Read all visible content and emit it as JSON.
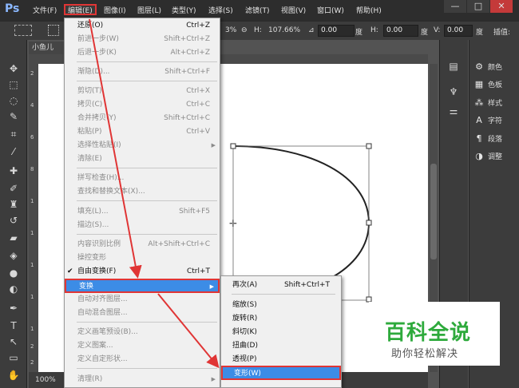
{
  "app": {
    "logo": "Ps"
  },
  "menubar": {
    "items": [
      "文件(F)",
      "编辑(E)",
      "图像(I)",
      "图层(L)",
      "类型(Y)",
      "选择(S)",
      "滤镜(T)",
      "视图(V)",
      "窗口(W)",
      "帮助(H)"
    ],
    "window_controls": [
      "—",
      "□",
      "✕"
    ]
  },
  "options": {
    "pct": "3%",
    "h_label": "H:",
    "h_value": "107.66%",
    "angle": "0.00",
    "deg1": "度",
    "h2_label": "H:",
    "h2_value": "0.00",
    "deg2": "度",
    "v_label": "V:",
    "v_value": "0.00",
    "deg3": "度",
    "interp": "插值:"
  },
  "document": {
    "tab": "小鱼儿",
    "zoom": "100%",
    "ruler_ticks": [
      "2",
      "4",
      "6",
      "8",
      "1",
      "1",
      "1",
      "1",
      "1",
      "2",
      "2"
    ]
  },
  "edit_menu": {
    "items": [
      {
        "label": "还原(O)",
        "shortcut": "Ctrl+Z",
        "disabled": false
      },
      {
        "label": "前进一步(W)",
        "shortcut": "Shift+Ctrl+Z",
        "disabled": true
      },
      {
        "label": "后退一步(K)",
        "shortcut": "Alt+Ctrl+Z",
        "disabled": true
      },
      {
        "label": "渐隐(D)...",
        "shortcut": "Shift+Ctrl+F",
        "disabled": true
      },
      {
        "label": "剪切(T)",
        "shortcut": "Ctrl+X",
        "disabled": true
      },
      {
        "label": "拷贝(C)",
        "shortcut": "Ctrl+C",
        "disabled": true
      },
      {
        "label": "合并拷贝(Y)",
        "shortcut": "Shift+Ctrl+C",
        "disabled": true
      },
      {
        "label": "粘贴(P)",
        "shortcut": "Ctrl+V",
        "disabled": true
      },
      {
        "label": "选择性粘贴(I)",
        "shortcut": "",
        "disabled": true
      },
      {
        "label": "清除(E)",
        "shortcut": "",
        "disabled": true
      },
      {
        "label": "拼写检查(H)...",
        "shortcut": "",
        "disabled": true
      },
      {
        "label": "查找和替换文本(X)...",
        "shortcut": "",
        "disabled": true
      },
      {
        "label": "填充(L)...",
        "shortcut": "Shift+F5",
        "disabled": true
      },
      {
        "label": "描边(S)...",
        "shortcut": "",
        "disabled": true
      },
      {
        "label": "内容识别比例",
        "shortcut": "Alt+Shift+Ctrl+C",
        "disabled": true
      },
      {
        "label": "操控变形",
        "shortcut": "",
        "disabled": true
      },
      {
        "label": "自由变换(F)",
        "shortcut": "Ctrl+T",
        "disabled": false
      },
      {
        "label": "变换",
        "shortcut": "",
        "disabled": false
      },
      {
        "label": "自动对齐图层...",
        "shortcut": "",
        "disabled": true
      },
      {
        "label": "自动混合图层...",
        "shortcut": "",
        "disabled": true
      },
      {
        "label": "定义画笔预设(B)...",
        "shortcut": "",
        "disabled": true
      },
      {
        "label": "定义图案...",
        "shortcut": "",
        "disabled": true
      },
      {
        "label": "定义自定形状...",
        "shortcut": "",
        "disabled": true
      },
      {
        "label": "清理(R)",
        "shortcut": "",
        "disabled": true
      }
    ],
    "checkmark": "✔",
    "submenu_arrow": "▶"
  },
  "transform_submenu": {
    "items": [
      {
        "label": "再次(A)",
        "shortcut": "Shift+Ctrl+T"
      },
      {
        "label": "缩放(S)",
        "shortcut": ""
      },
      {
        "label": "旋转(R)",
        "shortcut": ""
      },
      {
        "label": "斜切(K)",
        "shortcut": ""
      },
      {
        "label": "扭曲(D)",
        "shortcut": ""
      },
      {
        "label": "透视(P)",
        "shortcut": ""
      },
      {
        "label": "变形(W)",
        "shortcut": ""
      }
    ]
  },
  "panels": {
    "items": [
      {
        "label": "颜色",
        "icon": "palette-icon"
      },
      {
        "label": "色板",
        "icon": "swatches-icon"
      },
      {
        "label": "样式",
        "icon": "styles-icon"
      },
      {
        "label": "字符",
        "icon": "character-icon"
      },
      {
        "label": "段落",
        "icon": "paragraph-icon"
      },
      {
        "label": "调整",
        "icon": "adjustments-icon"
      }
    ]
  },
  "watermark": {
    "brand": "百科全说",
    "slogan": "助你轻松解决"
  },
  "colors": {
    "highlight": "#3c8ce6",
    "annotation": "#e03535",
    "brand_green": "#2eaa3c"
  }
}
